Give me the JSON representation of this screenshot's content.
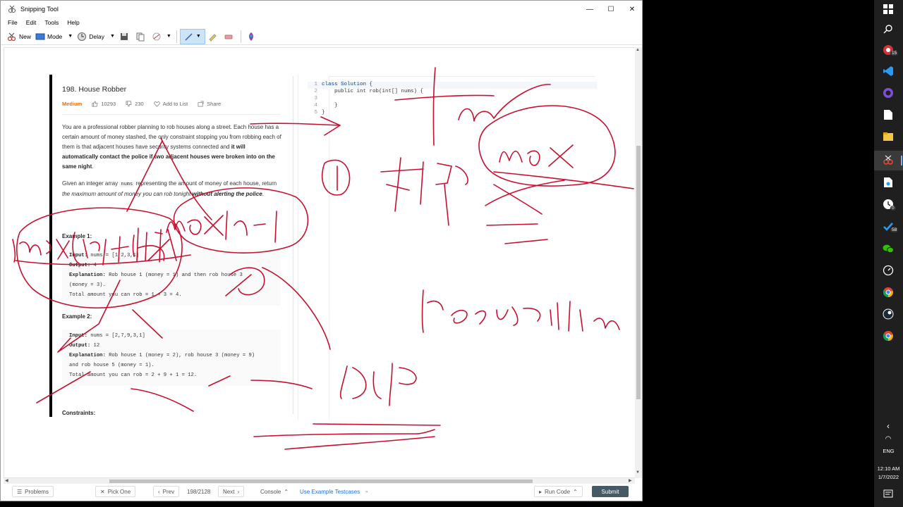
{
  "window": {
    "title": "Snipping Tool",
    "controls": {
      "minimize": "—",
      "maximize": "☐",
      "close": "✕"
    }
  },
  "menu": [
    "File",
    "Edit",
    "Tools",
    "Help"
  ],
  "toolbar": {
    "new_label": "New",
    "mode_label": "Mode",
    "delay_label": "Delay"
  },
  "problem": {
    "title": "198. House Robber",
    "difficulty": "Medium",
    "likes": "10293",
    "dislikes": "230",
    "add_to_list": "Add to List",
    "share": "Share",
    "description_1a": "You are a professional robber planning to rob houses along a street. Each house has a certain amount of money stashed, the only constraint stopping you from robbing each of them is that adjacent houses have security systems connected and ",
    "description_1b": "it will automatically contact the police if two adjacent houses were broken into on the same night",
    "description_1c": ".",
    "description_2a": "Given an integer array ",
    "description_2_code": "nums",
    "description_2b": " representing the amount of money of each house, return ",
    "description_2_italic": "the maximum amount of money you can rob tonight ",
    "description_2_bold": "without alerting the police",
    "description_2c": ".",
    "example1_title": "Example 1:",
    "example1": {
      "input_k": "Input:",
      "input_v": " nums = [1,2,3,1]",
      "output_k": "Output:",
      "output_v": " 4",
      "expl_k": "Explanation:",
      "expl_v1": " Rob house 1 (money = 1) and then rob house 3",
      "expl_v2": "(money = 3).",
      "total": "Total amount you can rob = 1 + 3 = 4."
    },
    "example2_title": "Example 2:",
    "example2": {
      "input_k": "Input:",
      "input_v": " nums = [2,7,9,3,1]",
      "output_k": "Output:",
      "output_v": " 12",
      "expl_k": "Explanation:",
      "expl_v1": " Rob house 1 (money = 2), rob house 3 (money = 9)",
      "expl_v2": "and rob house 5 (money = 1).",
      "total": "Total amount you can rob = 2 + 9 + 1 = 12."
    },
    "constraints_title": "Constraints:"
  },
  "editor": {
    "lines": [
      {
        "n": "1",
        "code": "class Solution {"
      },
      {
        "n": "2",
        "code": "    public int rob(int[] nums) {"
      },
      {
        "n": "3",
        "code": ""
      },
      {
        "n": "4",
        "code": "    }"
      },
      {
        "n": "5",
        "code": "}"
      }
    ]
  },
  "bottom_bar": {
    "problems": "Problems",
    "pick_one": "Pick One",
    "prev": "Prev",
    "page": "198/2128",
    "next": "Next",
    "console": "Console",
    "use_example": "Use Example Testcases",
    "run_code": "Run Code",
    "submit": "Submit"
  },
  "taskbar": {
    "badge_mail": "15",
    "badge_clock": "0",
    "badge_todo": "58",
    "language": "ENG",
    "time": "12:10 AM",
    "date": "1/7/2022"
  },
  "colors": {
    "ink": "#c8102e",
    "difficulty": "#ef6c00",
    "submit": "#455a64"
  }
}
